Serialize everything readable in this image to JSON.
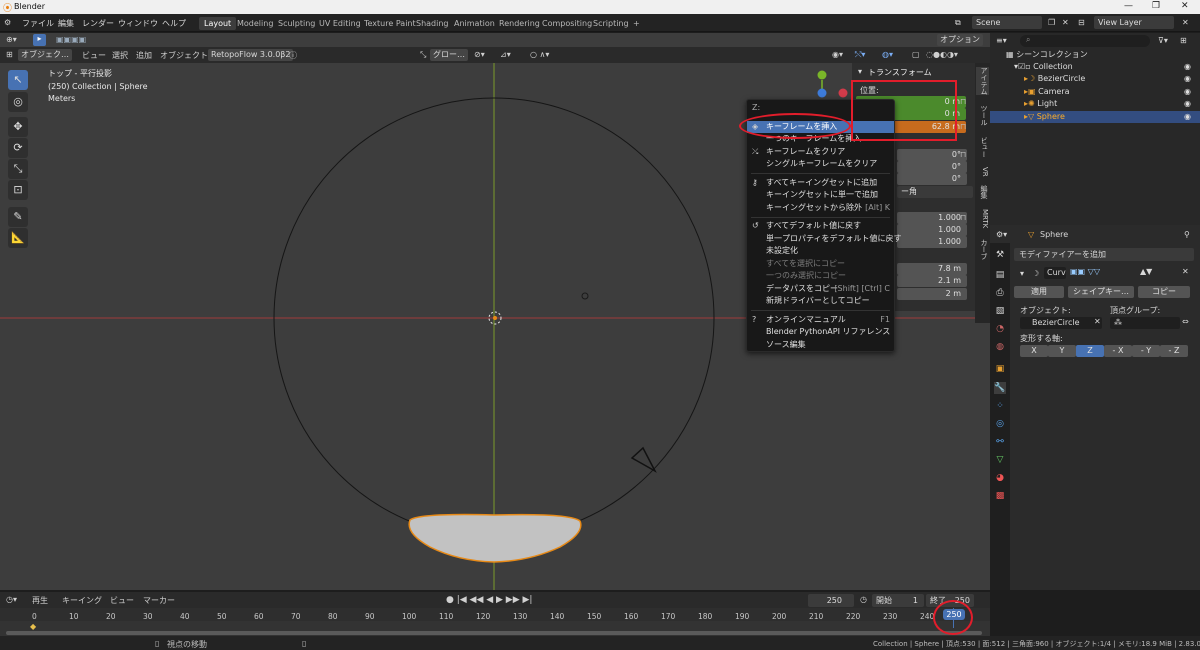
{
  "window": {
    "title": "Blender",
    "min": "—",
    "max": "❐",
    "close": "✕"
  },
  "menus": [
    "ファイル",
    "編集",
    "レンダー",
    "ウィンドウ",
    "ヘルプ"
  ],
  "workspaces": [
    "Layout",
    "Modeling",
    "Sculpting",
    "UV Editing",
    "Texture Paint",
    "Shading",
    "Animation",
    "Rendering",
    "Compositing",
    "Scripting"
  ],
  "workspace_add": "+",
  "scene": {
    "label": "Scene",
    "view_layer": "View Layer"
  },
  "vp_header": {
    "mode": "オブジェク…",
    "view": "ビュー",
    "select": "選択",
    "add": "追加",
    "object": "オブジェクト",
    "addon": "RetopoFlow 3.0.0β2",
    "orientation": "グロー…",
    "options": "オプション"
  },
  "viewport_info": {
    "line1": "トップ - 平行投影",
    "line2": "(250) Collection | Sphere",
    "line3": "Meters"
  },
  "npanel": {
    "title": "トランスフォーム",
    "location_label": "位置:",
    "loc": [
      "0 m",
      "0 m",
      "62.8 m"
    ],
    "rot": [
      "0°",
      "0°",
      "0°"
    ],
    "rot_mode": "ー角",
    "scale": [
      "1.000",
      "1.000",
      "1.000"
    ],
    "dims": [
      "7.8 m",
      "2.1 m",
      "2 m"
    ]
  },
  "sidetabs": [
    "アイテム",
    "ツール",
    "ビュー",
    "VR",
    "編集",
    "MRTK",
    "カーブ"
  ],
  "context_menu": {
    "header": "Z:",
    "items": [
      {
        "label": "キーフレームを挿入",
        "shortcut": "",
        "icon": "keyframe-icon",
        "state": "highlight"
      },
      {
        "label": "一つのキーフレームを挿入",
        "shortcut": "",
        "icon": "",
        "state": "normal"
      },
      {
        "label": "キーフレームをクリア",
        "shortcut": "",
        "icon": "clear-keyframe-icon",
        "state": "normal"
      },
      {
        "label": "シングルキーフレームをクリア",
        "shortcut": "",
        "icon": "",
        "state": "normal"
      },
      {
        "label": "すべてキーイングセットに追加",
        "shortcut": "",
        "icon": "keying-set-icon",
        "state": "normal"
      },
      {
        "label": "キーイングセットに単一で追加",
        "shortcut": "",
        "icon": "",
        "state": "normal"
      },
      {
        "label": "キーイングセットから除外",
        "shortcut": "[Alt] K",
        "icon": "",
        "state": "normal"
      },
      {
        "label": "すべてデフォルト値に戻す",
        "shortcut": "",
        "icon": "reset-icon",
        "state": "normal"
      },
      {
        "label": "単一プロパティをデフォルト値に戻す",
        "shortcut": "",
        "icon": "",
        "state": "normal"
      },
      {
        "label": "未設定化",
        "shortcut": "",
        "icon": "",
        "state": "normal"
      },
      {
        "label": "すべてを選択にコピー",
        "shortcut": "",
        "icon": "",
        "state": "disabled"
      },
      {
        "label": "一つのみ選択にコピー",
        "shortcut": "",
        "icon": "",
        "state": "disabled"
      },
      {
        "label": "データパスをコピー",
        "shortcut": "[Shift] [Ctrl] C",
        "icon": "",
        "state": "normal"
      },
      {
        "label": "新規ドライバーとしてコピー",
        "shortcut": "",
        "icon": "",
        "state": "normal"
      },
      {
        "label": "オンラインマニュアル",
        "shortcut": "F1",
        "icon": "help-icon",
        "state": "normal"
      },
      {
        "label": "Blender PythonAPI リファレンス",
        "shortcut": "",
        "icon": "",
        "state": "normal"
      },
      {
        "label": "ソース編集",
        "shortcut": "",
        "icon": "",
        "state": "normal"
      }
    ]
  },
  "outliner": {
    "title": "シーンコレクション",
    "items": [
      {
        "label": "Collection",
        "icon": "collection-icon",
        "indent": 0
      },
      {
        "label": "BezierCircle",
        "icon": "curve-icon",
        "indent": 1
      },
      {
        "label": "Camera",
        "icon": "camera-icon",
        "indent": 1
      },
      {
        "label": "Light",
        "icon": "light-icon",
        "indent": 1
      },
      {
        "label": "Sphere",
        "icon": "mesh-icon",
        "indent": 1
      }
    ]
  },
  "properties": {
    "object_name": "Sphere",
    "add_modifier": "モディファイアーを追加",
    "modifier_name": "Curv",
    "apply": "適用",
    "shapekey": "シェイプキー…",
    "copy": "コピー",
    "object_label": "オブジェクト:",
    "object_value": "BezierCircle",
    "vgroup_label": "頂点グループ:",
    "deform_axis_label": "変形する軸:",
    "axes": [
      "X",
      "Y",
      "Z",
      "- X",
      "- Y",
      "- Z"
    ],
    "active_axis": "Z"
  },
  "timeline": {
    "playback": "再生",
    "keying": "キーイング",
    "view": "ビュー",
    "marker": "マーカー",
    "current_frame": "250",
    "start_label": "開始",
    "start": "1",
    "end_label": "終了",
    "end": "250",
    "ticks": [
      "0",
      "10",
      "20",
      "30",
      "40",
      "50",
      "60",
      "70",
      "80",
      "90",
      "100",
      "110",
      "120",
      "130",
      "140",
      "150",
      "160",
      "170",
      "180",
      "190",
      "200",
      "210",
      "220",
      "230",
      "240"
    ],
    "playhead": "250"
  },
  "status": {
    "left": "視点の移動",
    "right": "Collection | Sphere | 頂点:530 | 面:512 | 三角面:960 | オブジェクト:1/4 | メモリ:18.9 MiB | 2.83.0"
  },
  "colors": {
    "accent": "#4772b3",
    "annotation": "#e21d2b",
    "x_field": "#4b8a2c",
    "z_field": "#c76b1d"
  }
}
